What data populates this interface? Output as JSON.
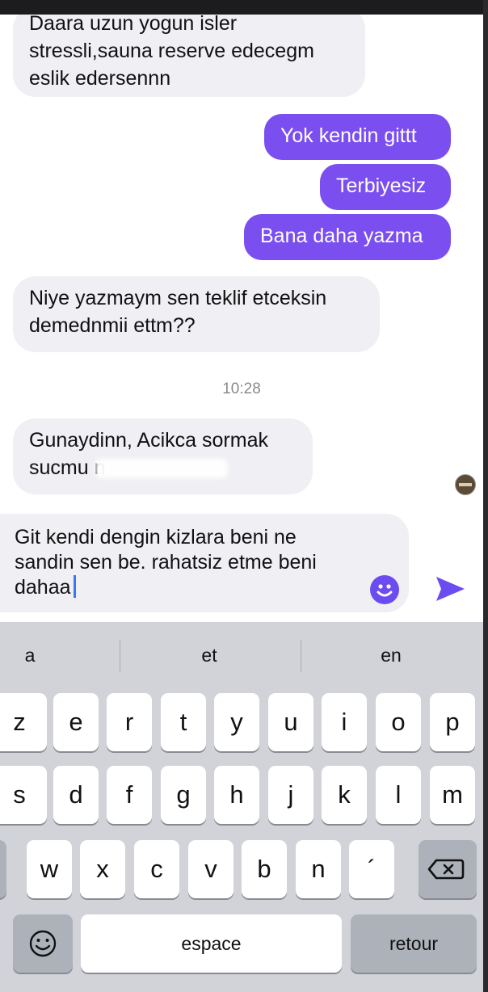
{
  "messages": [
    {
      "dir": "in",
      "text": "Daara uzun yogun isler\nstressli,sauna reserve edecegm\neslik edersennn"
    },
    {
      "dir": "out",
      "text": "Yok kendin gittt"
    },
    {
      "dir": "out",
      "text": "Terbiyesiz"
    },
    {
      "dir": "out",
      "text": "Bana daha yazma"
    },
    {
      "dir": "in",
      "text": "Niye yazmaym sen teklif etceksin\ndemednmii ettm??"
    },
    {
      "dir": "in",
      "text": "Gunaydinn, Acikca sormak\nsucmu n"
    }
  ],
  "timestamp": "10:28",
  "composer": {
    "value": "Git kendi dengin kizlara beni ne\nsandin sen be. rahatsiz etme beni\ndahaa",
    "accent": "#6c4cf0"
  },
  "keyboard": {
    "suggestions": [
      "a",
      "et",
      "en"
    ],
    "row1": [
      "z",
      "e",
      "r",
      "t",
      "y",
      "u",
      "i",
      "o",
      "p"
    ],
    "row2": [
      "s",
      "d",
      "f",
      "g",
      "h",
      "j",
      "k",
      "l",
      "m"
    ],
    "row3": [
      "w",
      "x",
      "c",
      "v",
      "b",
      "n",
      "´"
    ],
    "space": "espace",
    "return": "retour"
  },
  "colors": {
    "outgoing": "#7b4ef0",
    "incoming": "#efeff4"
  }
}
